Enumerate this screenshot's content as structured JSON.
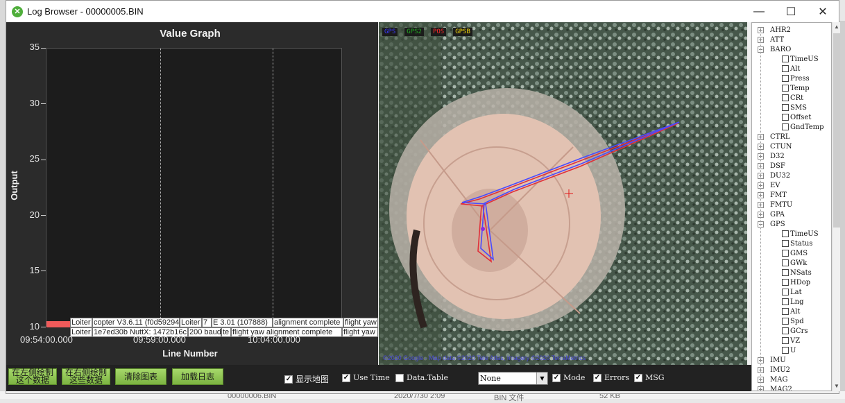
{
  "window": {
    "title": "Log Browser - 00000005.BIN",
    "minimize": "—",
    "maximize": "☐",
    "close": "✕"
  },
  "graph": {
    "title": "Value Graph",
    "ylabel": "Output",
    "xlabel": "Line Number",
    "yticks": [
      "35",
      "30",
      "25",
      "20",
      "15",
      "10"
    ],
    "xticks": [
      "09:54:00.000",
      "09:59:00.000",
      "10:04:00.000"
    ],
    "messages_row1": [
      "Loiter",
      "copter V3.6.11 (f0d59294",
      "Loiter",
      "7",
      "E 3.01 (107888)",
      "alignment complete",
      "flight yaw"
    ],
    "messages_row2": [
      "Loiter",
      "1e7ed30b NuttX: 1472b16c",
      "200 baud",
      "te",
      "flight yaw alignment complete",
      "flight yaw"
    ]
  },
  "map": {
    "legend": [
      {
        "label": "GPS",
        "color": "#3a3aff"
      },
      {
        "label": "GPS2",
        "color": "#22aa22"
      },
      {
        "label": "POS",
        "color": "#ff2a2a"
      },
      {
        "label": "GPSB",
        "color": "#f5d90a"
      }
    ],
    "attribution": "©2020 Google - Map data ©2020 Tele Atlas, Imagery ©2020 TerraMetrics"
  },
  "tree": {
    "items": [
      {
        "label": "AHR2",
        "type": "group",
        "expanded": false
      },
      {
        "label": "ATT",
        "type": "group",
        "expanded": false
      },
      {
        "label": "BARO",
        "type": "group",
        "expanded": true
      },
      {
        "label": "TimeUS",
        "type": "field"
      },
      {
        "label": "Alt",
        "type": "field"
      },
      {
        "label": "Press",
        "type": "field"
      },
      {
        "label": "Temp",
        "type": "field"
      },
      {
        "label": "CRt",
        "type": "field"
      },
      {
        "label": "SMS",
        "type": "field"
      },
      {
        "label": "Offset",
        "type": "field"
      },
      {
        "label": "GndTemp",
        "type": "field"
      },
      {
        "label": "CTRL",
        "type": "group",
        "expanded": false
      },
      {
        "label": "CTUN",
        "type": "group",
        "expanded": false
      },
      {
        "label": "D32",
        "type": "group",
        "expanded": false
      },
      {
        "label": "DSF",
        "type": "group",
        "expanded": false
      },
      {
        "label": "DU32",
        "type": "group",
        "expanded": false
      },
      {
        "label": "EV",
        "type": "group",
        "expanded": false
      },
      {
        "label": "FMT",
        "type": "group",
        "expanded": false
      },
      {
        "label": "FMTU",
        "type": "group",
        "expanded": false
      },
      {
        "label": "GPA",
        "type": "group",
        "expanded": false
      },
      {
        "label": "GPS",
        "type": "group",
        "expanded": true
      },
      {
        "label": "TimeUS",
        "type": "field"
      },
      {
        "label": "Status",
        "type": "field"
      },
      {
        "label": "GMS",
        "type": "field"
      },
      {
        "label": "GWk",
        "type": "field"
      },
      {
        "label": "NSats",
        "type": "field"
      },
      {
        "label": "HDop",
        "type": "field"
      },
      {
        "label": "Lat",
        "type": "field"
      },
      {
        "label": "Lng",
        "type": "field"
      },
      {
        "label": "Alt",
        "type": "field"
      },
      {
        "label": "Spd",
        "type": "field"
      },
      {
        "label": "GCrs",
        "type": "field"
      },
      {
        "label": "VZ",
        "type": "field"
      },
      {
        "label": "U",
        "type": "field"
      },
      {
        "label": "IMU",
        "type": "group",
        "expanded": false
      },
      {
        "label": "IMU2",
        "type": "group",
        "expanded": false
      },
      {
        "label": "MAG",
        "type": "group",
        "expanded": false
      },
      {
        "label": "MAG2",
        "type": "group",
        "expanded": false
      }
    ]
  },
  "toolbar": {
    "btn_left_data": "在左侧绘制\n这个数据",
    "btn_right_data": "在右侧绘制\n这些数据",
    "btn_clear": "清除图表",
    "btn_load": "加载日志",
    "chk_map": {
      "label": "显示地图",
      "checked": true
    },
    "chk_time": {
      "label": "Use Time",
      "checked": true
    },
    "chk_table": {
      "label": "Data.Table",
      "checked": false
    },
    "combo_value": "None",
    "chk_mode": {
      "label": "Mode",
      "checked": true
    },
    "chk_errors": {
      "label": "Errors",
      "checked": true
    },
    "chk_msg": {
      "label": "MSG",
      "checked": true
    }
  },
  "background": {
    "filename": "00000006.BIN",
    "date": "2020/7/30 2:09",
    "type": "BIN 文件",
    "size": "52 KB"
  }
}
